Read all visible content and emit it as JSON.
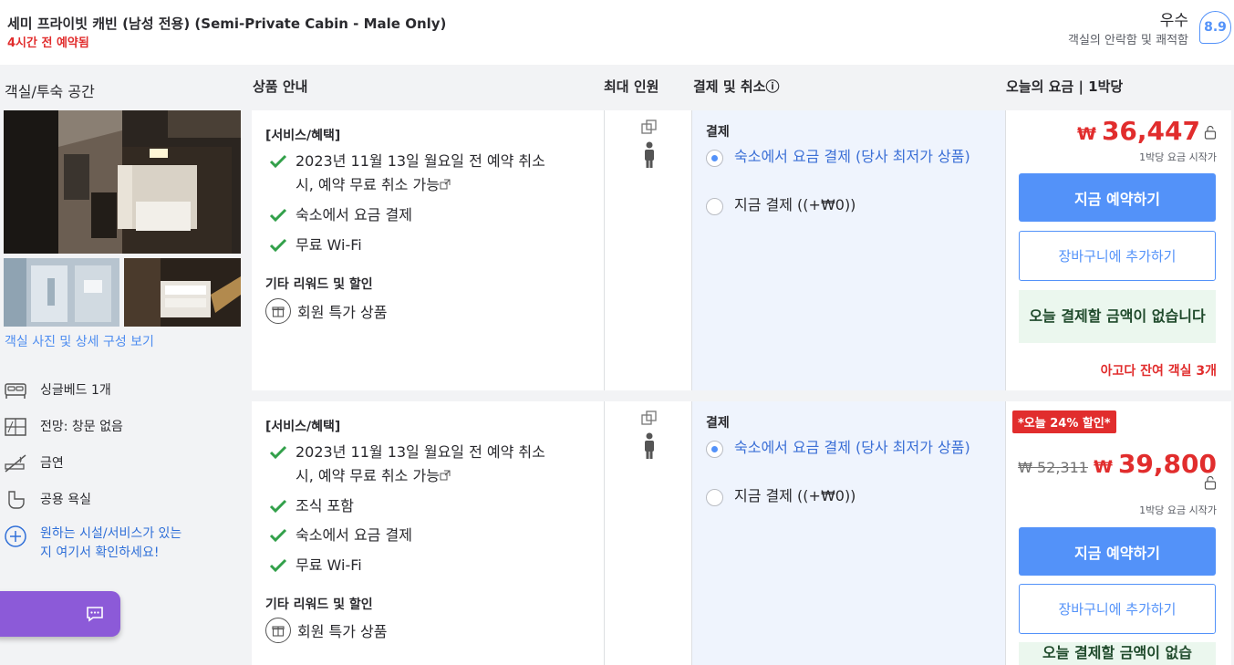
{
  "header": {
    "room_title": "세미 프라이빗 캐빈 (남성 전용) (Semi-Private Cabin - Male Only)",
    "booked_text": "4시간 전 예약됨",
    "rating_word": "우수",
    "rating_desc": "객실의 안락함 및 쾌적함",
    "score": "8.9"
  },
  "columns": {
    "room_space": "객실/투숙 공간",
    "product_info": "상품 안내",
    "max_guests": "최대 인원",
    "pay_cancel": "결제 및 취소ⓘ",
    "today_rate": "오늘의 요금 | 1박당"
  },
  "left": {
    "photos_link": "객실 사진 및 상세 구성 보기",
    "facilities": [
      {
        "icon": "bed-icon",
        "label": "싱글베드 1개"
      },
      {
        "icon": "window-icon",
        "label": "전망: 창문 없음"
      },
      {
        "icon": "no-smoking-icon",
        "label": "금연"
      },
      {
        "icon": "bathtub-icon",
        "label": "공용 욕실"
      }
    ],
    "more_text_1": "원하는 시설/서비스가 있는",
    "more_text_2": "지 여기서 확인하세요!"
  },
  "offers": [
    {
      "services_head": "[서비스/혜택]",
      "benefits": [
        {
          "line1": "2023년 11월 13일 월요일 전 예약 취소",
          "line2": "시, 예약 무료 취소 가능"
        },
        {
          "line1": "숙소에서 요금 결제"
        },
        {
          "line1": "무료 Wi-Fi"
        }
      ],
      "other_head": "기타 리워드 및 할인",
      "member_deal": "회원 특가 상품",
      "pay_head": "결제",
      "pay_options": [
        {
          "label": "숙소에서 요금 결제 (당사 최저가 상품)",
          "selected": true
        },
        {
          "label": "지금 결제 ((+₩0))",
          "selected": false
        }
      ],
      "currency": "₩",
      "price": "36,447",
      "per_night": "1박당 요금 시작가",
      "book_label": "지금 예약하기",
      "cart_label": "장바구니에 추가하기",
      "no_pay_label": "오늘 결제할 금액이 없습니다",
      "rooms_left": "아고다 잔여 객실 3개"
    },
    {
      "discount_badge": "*오늘 24% 할인*",
      "services_head": "[서비스/혜택]",
      "benefits": [
        {
          "line1": "2023년 11월 13일 월요일 전 예약 취소",
          "line2": "시, 예약 무료 취소 가능"
        },
        {
          "line1": "조식 포함"
        },
        {
          "line1": "숙소에서 요금 결제"
        },
        {
          "line1": "무료 Wi-Fi"
        }
      ],
      "other_head": "기타 리워드 및 할인",
      "member_deal": "회원 특가 상품",
      "pay_head": "결제",
      "pay_options": [
        {
          "label": "숙소에서 요금 결제 (당사 최저가 상품)",
          "selected": true
        },
        {
          "label": "지금 결제 ((+₩0))",
          "selected": false
        }
      ],
      "original_price": "₩ 52,311",
      "currency": "₩",
      "price": "39,800",
      "per_night": "1박당 요금 시작가",
      "book_label": "지금 예약하기",
      "cart_label": "장바구니에 추가하기",
      "no_pay_label": "오늘 결제할 금액이 없습"
    }
  ],
  "colors": {
    "accent": "#5392f9",
    "price_red": "#e12d2d",
    "chat_purple": "#8c5ad8"
  }
}
